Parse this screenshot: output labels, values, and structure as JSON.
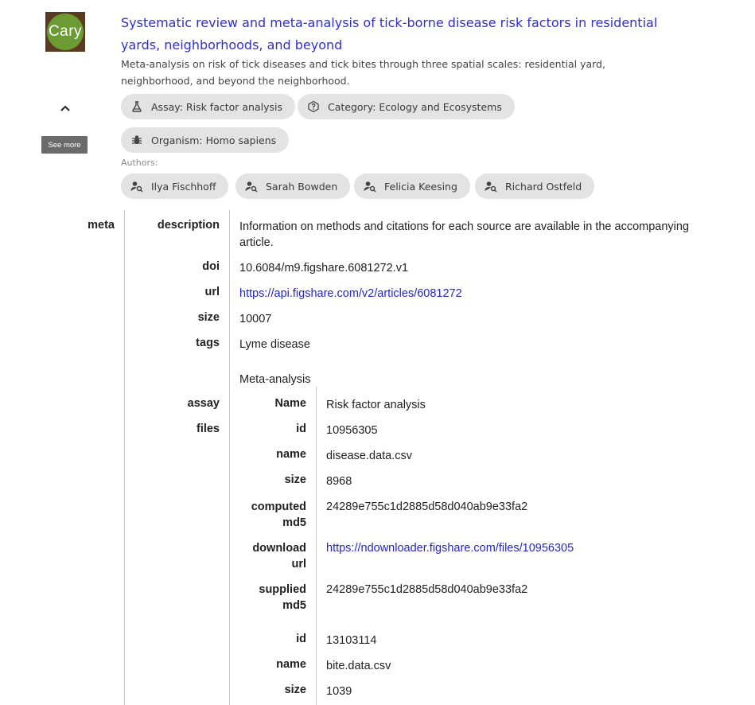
{
  "logo": {
    "text": "Cary"
  },
  "header": {
    "title": "Systematic review and meta-analysis of tick-borne disease risk factors in residential yards, neighborhoods, and beyond",
    "description": "Meta-analysis on risk of tick diseases and tick bites through three spatial scales: residential yard, neighborhood, and beyond the neighborhood.",
    "see_more": "See more",
    "collapse_icon": "chevron-up-icon"
  },
  "chips": [
    {
      "label": "Assay: Risk factor analysis",
      "icon": "flask-icon"
    },
    {
      "label": "Category: Ecology and Ecosystems",
      "icon": "help-circle-icon"
    },
    {
      "label": "Organism: Homo sapiens",
      "icon": "bug-icon"
    }
  ],
  "authors_label": "Authors:",
  "authors": [
    {
      "name": "Ilya Fischhoff",
      "icon": "user-search-icon"
    },
    {
      "name": "Sarah Bowden",
      "icon": "user-search-icon"
    },
    {
      "name": "Felicia Keesing",
      "icon": "user-search-icon"
    },
    {
      "name": "Richard Ostfeld",
      "icon": "user-search-icon"
    }
  ],
  "table": {
    "meta_label": "meta",
    "meta": {
      "description_label": "description",
      "description": "Information on methods and citations for each source are available in the accompanying article.",
      "doi_label": "doi",
      "doi": "10.6084/m9.figshare.6081272.v1",
      "url_label": "url",
      "url": "https://api.figshare.com/v2/articles/6081272",
      "size_label": "size",
      "size": "10007",
      "tags_label": "tags",
      "tags": [
        "Lyme disease",
        "Meta-analysis"
      ]
    },
    "assay_label": "assay",
    "assay": {
      "name_label": "Name",
      "name": "Risk factor analysis"
    },
    "files_label": "files",
    "files": [
      {
        "id_label": "id",
        "id": "10956305",
        "name_label": "name",
        "name": "disease.data.csv",
        "size_label": "size",
        "size": "8968",
        "computed_md5_label": [
          "computed",
          "md5"
        ],
        "computed_md5": "24289e755c1d2885d58d040ab9e33fa2",
        "download_url_label": [
          "download",
          "url"
        ],
        "download_url": "https://ndownloader.figshare.com/files/10956305",
        "supplied_md5_label": [
          "supplied",
          "md5"
        ],
        "supplied_md5": "24289e755c1d2885d58d040ab9e33fa2"
      },
      {
        "id_label": "id",
        "id": "13103114",
        "name_label": "name",
        "name": "bite.data.csv",
        "size_label": "size",
        "size": "1039"
      }
    ]
  },
  "colors": {
    "link": "#2f2fd1",
    "chip_bg": "#e3e3e3",
    "logo_bg": "#5b3a22",
    "logo_circle": "#6b9b32"
  }
}
